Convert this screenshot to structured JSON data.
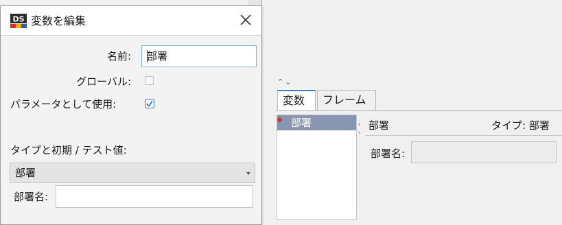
{
  "dialog": {
    "title": "変数を編集",
    "logo_text": "DS",
    "name_label": "名前:",
    "name_value": "部署",
    "global_label": "グローバル:",
    "global_checked": false,
    "param_label": "パラメータとして使用:",
    "param_checked": true,
    "type_section_label": "タイプと初期 / テスト値:",
    "type_value": "部署",
    "dept_field_label": "部署名:",
    "dept_field_value": ""
  },
  "panel": {
    "tabs": [
      {
        "label": "変数",
        "active": true
      },
      {
        "label": "フレーム",
        "active": false
      }
    ],
    "variables": [
      {
        "label": "部署",
        "selected": true
      }
    ],
    "detail": {
      "name": "部署",
      "type": "タイプ: 部署",
      "dept_field_label": "部署名:"
    }
  },
  "colors": {
    "accent": "#3c7fc2",
    "selection": "#8896b0",
    "logo_red": "#e2272c",
    "logo_blue": "#2b5fa8",
    "logo_yellow": "#f4b400"
  }
}
